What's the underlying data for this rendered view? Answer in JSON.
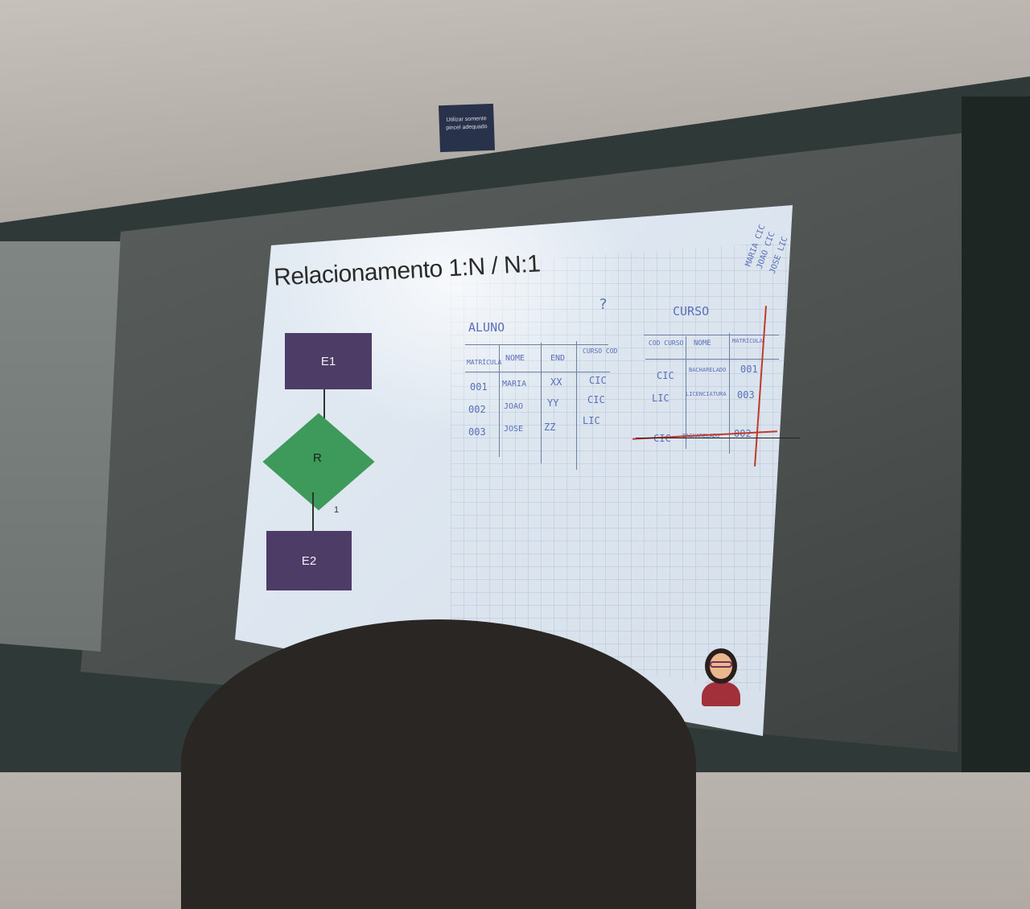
{
  "sign": {
    "text": "Utilizar somente pincel adequado"
  },
  "slide": {
    "title": "Relacionamento 1:N / N:1",
    "entity_top": "E1",
    "relationship": "R",
    "cardinality": "1",
    "entity_bottom": "E2"
  },
  "board": {
    "question_mark": "?",
    "aluno": {
      "title": "ALUNO",
      "headers": [
        "MATRÍCULA",
        "NOME",
        "END",
        "CURSO COD"
      ],
      "rows": [
        [
          "001",
          "MARIA",
          "XX",
          "CIC"
        ],
        [
          "002",
          "JOAO",
          "YY",
          "CIC"
        ],
        [
          "003",
          "JOSE",
          "ZZ",
          "LIC"
        ]
      ]
    },
    "curso": {
      "title": "CURSO",
      "headers": [
        "COD CURSO",
        "NOME",
        "MATRÍCULA"
      ],
      "rows": [
        [
          "CIC",
          "BACHARELADO",
          "001"
        ],
        [
          "LIC",
          "LICENCIATURA",
          "003"
        ],
        [
          "CIC",
          "BACHARELADO",
          "002"
        ]
      ]
    },
    "side_notes": [
      "MARIA CIC",
      "JOAO CIC",
      "JOSE LIC"
    ]
  },
  "colors": {
    "entity": "#4d3d66",
    "relationship": "#3e9a5a",
    "marker_blue": "#5a6fb8",
    "marker_red": "#c0392b"
  }
}
